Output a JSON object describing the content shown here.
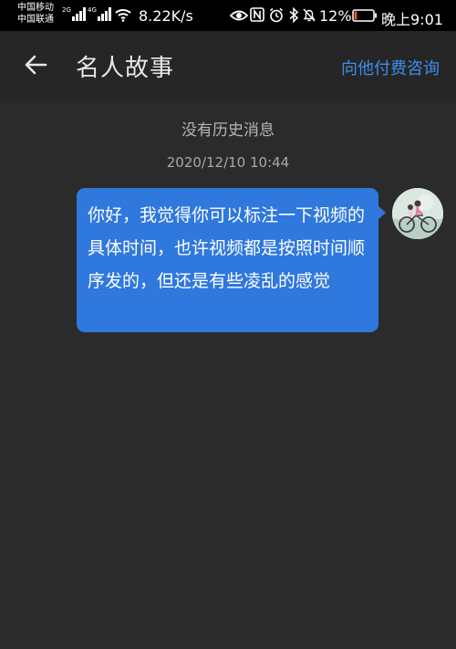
{
  "status_bar": {
    "carrier_1": "中国移动",
    "carrier_2": "中国联通",
    "net_tag_1": "2G",
    "net_tag_2": "4G",
    "net_speed": "8.22K/s",
    "battery_percent": "12%",
    "battery_level": 0.12,
    "time": "晚上9:01"
  },
  "header": {
    "title": "名人故事",
    "consult_label": "向他付费咨询"
  },
  "chat": {
    "history_note": "没有历史消息",
    "timestamp": "2020/12/10 10:44",
    "messages": [
      {
        "text": "你好，我觉得你可以标注一下视频的具体时间，也许视频都是按照时间顺序发的，但还是有些凌乱的感觉"
      }
    ]
  },
  "colors": {
    "accent": "#3d8ef0",
    "bubble": "#2f78dd",
    "background": "#2b2b2b"
  }
}
